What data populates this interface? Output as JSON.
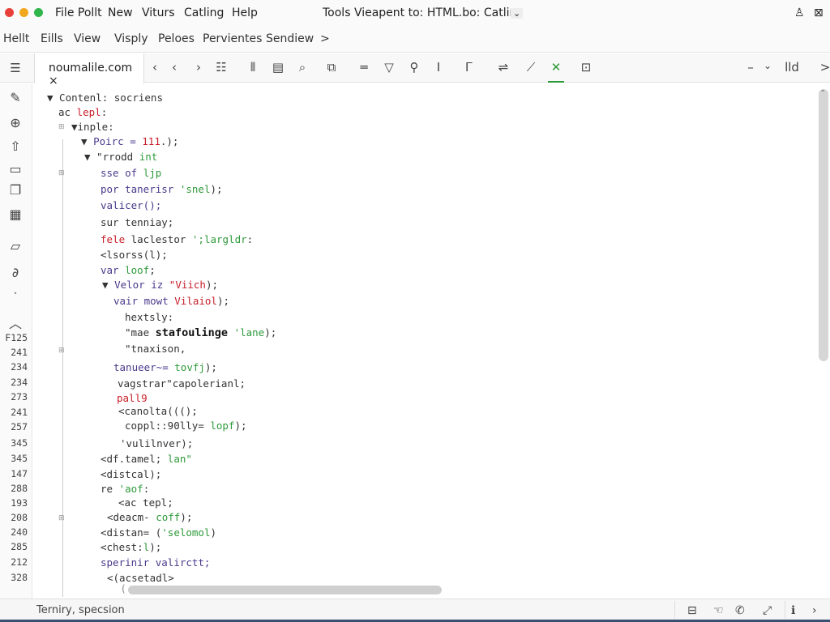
{
  "titlebar": {
    "menus": [
      "File Pollt",
      "New",
      "Viturs",
      "Catling",
      "Help"
    ],
    "title": "Tools Vieapent to: HTML.bo: Catling",
    "title_chevron": "⌄",
    "icons": [
      "user-icon",
      "close-window-icon"
    ]
  },
  "menubar": {
    "items": [
      "Hellt",
      "Eills",
      "View",
      "Visply",
      "Peloes",
      "Pervientes",
      "Sendiew"
    ],
    "more": ">"
  },
  "tab": {
    "label": "noumalile.com",
    "close": "×"
  },
  "toolbar": {
    "icons": [
      "chevron-left-icon",
      "chevron-left-icon",
      "chevron-right-icon",
      "list-icon",
      "columns-icon",
      "document-lines-icon",
      "search-icon",
      "file-copy-icon",
      "minus-icon",
      "filter-icon",
      "pin-icon",
      "text-cursor-icon",
      "brackets-icon",
      "wrap-icon",
      "edit-icon",
      "close-icon",
      "panel-icon"
    ],
    "right": {
      "minus": "–",
      "dropdown": "⌄",
      "label": "lld",
      "next": ">"
    }
  },
  "activity_icons": [
    "pen-icon",
    "globe-icon",
    "upload-icon",
    "tag-icon",
    "files-icon",
    "grid-icon",
    "folder-icon",
    "branch-icon"
  ],
  "line_numbers": [
    "F125",
    "241",
    "234",
    "234",
    "273",
    "241",
    "257",
    "345",
    "345",
    "147",
    "288",
    "193",
    "208",
    "240",
    "285",
    "212",
    "328"
  ],
  "code_lines": [
    [
      [
        "",
        "▼ Contenl: socriens"
      ]
    ],
    [
      [
        "",
        "ac "
      ],
      [
        "r",
        "lepl"
      ],
      [
        "",
        ":"
      ]
    ],
    [
      [
        "",
        "▼inple:"
      ]
    ],
    [
      [
        "",
        "▼ "
      ],
      [
        "p",
        "Poirc = "
      ],
      [
        "r",
        "111"
      ],
      [
        "",
        ".);"
      ]
    ],
    [
      [
        "",
        "▼ \"rrodd "
      ],
      [
        "g",
        "int"
      ]
    ],
    [
      [
        "p",
        "sse of "
      ],
      [
        "g",
        "ljp"
      ]
    ],
    [
      [
        "p",
        "por tanerisr "
      ],
      [
        "g",
        "'snel"
      ],
      [
        "",
        ");"
      ]
    ],
    [
      [
        "p",
        "valicer();"
      ]
    ],
    [
      [
        "",
        "sur tenniay;"
      ]
    ],
    [
      [
        "r",
        "fele"
      ],
      [
        "",
        " laclestor "
      ],
      [
        "g",
        "';largldr"
      ],
      [
        "",
        ":"
      ]
    ],
    [
      [
        "",
        "<lsorss(l);"
      ]
    ],
    [
      [
        "p",
        "var "
      ],
      [
        "g",
        "loof"
      ],
      [
        "",
        ";"
      ]
    ],
    [
      [
        "",
        "▼ "
      ],
      [
        "p",
        "Velor iz "
      ],
      [
        "r",
        "\"Viich"
      ],
      [
        "",
        ");"
      ]
    ],
    [
      [
        "p",
        "vair mowt "
      ],
      [
        "r",
        "Vilaiol"
      ],
      [
        "",
        ");"
      ]
    ],
    [
      [
        "",
        "hextsly:"
      ]
    ],
    [
      [
        "",
        "\"mae "
      ],
      [
        "b",
        "stafoulinge"
      ],
      [
        "g",
        " 'lane"
      ],
      [
        "",
        ");"
      ]
    ],
    [
      [
        "",
        "\"tnaxison,"
      ]
    ],
    [
      [
        "p",
        "tanueer~= "
      ],
      [
        "g",
        "tovfj"
      ],
      [
        "",
        ");"
      ]
    ],
    [
      [
        "",
        "vagstrar\"capolerianl;"
      ]
    ],
    [
      [
        "r",
        "pall9"
      ]
    ],
    [
      [
        "",
        "<canolta((();"
      ]
    ],
    [
      [
        "",
        "coppl::90lly= "
      ],
      [
        "g",
        "lopf"
      ],
      [
        "",
        ");"
      ]
    ],
    [
      [
        "",
        "'vulilnver);"
      ]
    ],
    [
      [
        "",
        "<df.tamel; "
      ],
      [
        "g",
        "lan\""
      ]
    ],
    [
      [
        "",
        "<distcal);"
      ]
    ],
    [
      [
        "",
        "re "
      ],
      [
        "g",
        "'aof"
      ],
      [
        "",
        ":"
      ]
    ],
    [
      [
        "",
        "<ac tepl;"
      ]
    ],
    [
      [
        "",
        "<deacm- "
      ],
      [
        "g",
        "coff"
      ],
      [
        "",
        ");"
      ]
    ],
    [
      [
        "",
        "<distan= ("
      ],
      [
        "g",
        "'selomol"
      ],
      [
        "",
        ")"
      ]
    ],
    [
      [
        "",
        "<chest:"
      ],
      [
        "g",
        "l"
      ],
      [
        "",
        ");"
      ]
    ],
    [
      [
        "p",
        "sperinir valirctt;"
      ]
    ],
    [
      [
        "",
        "<(acsetadl>"
      ]
    ]
  ],
  "status": {
    "text": "Terniry, specsion",
    "icons": [
      "panel-icon",
      "hand-icon",
      "phone-icon",
      "expand-icon",
      "info-icon",
      "chevron-right-icon"
    ]
  },
  "colors": {
    "keyword": "#4b3a8c",
    "string": "#2e9a3a",
    "error": "#c8202a",
    "accent": "#2e9a3a"
  }
}
